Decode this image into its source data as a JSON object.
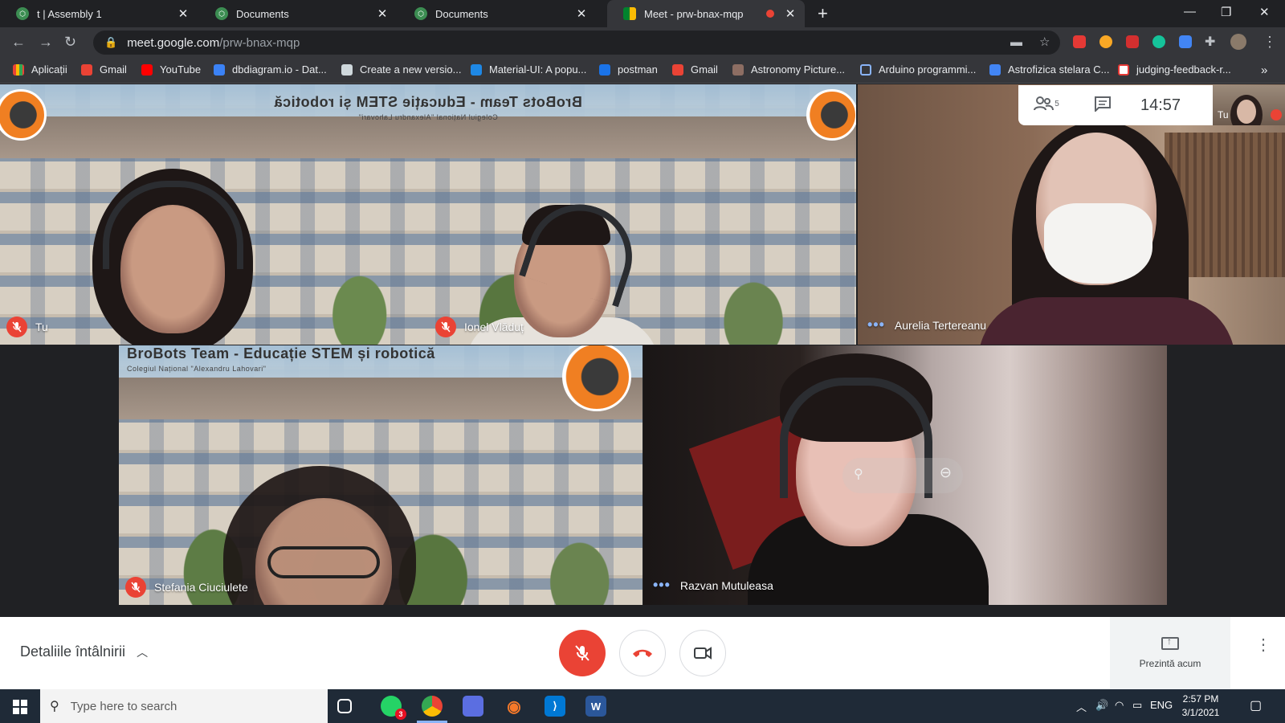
{
  "browser": {
    "tabs": [
      {
        "title": "t | Assembly 1",
        "active": false
      },
      {
        "title": "Documents",
        "active": false
      },
      {
        "title": "Documents",
        "active": false
      },
      {
        "title": "Meet - prw-bnax-mqp",
        "active": true
      }
    ],
    "url_host": "meet.google.com",
    "url_path": "/prw-bnax-mqp",
    "bookmarks": [
      "Aplicații",
      "Gmail",
      "YouTube",
      "dbdiagram.io - Dat...",
      "Create a new versio...",
      "Material-UI: A popu...",
      "postman",
      "Gmail",
      "Astronomy Picture...",
      "Arduino programmi...",
      "Astrofizica stelara C...",
      "judging-feedback-r..."
    ]
  },
  "meet": {
    "people_count": "5",
    "time": "14:57",
    "self_mini_label": "Tu",
    "banner_title": "BroBots Team - Educație STEM și robotică",
    "banner_subtitle": "Colegiul Național \"Alexandru Lahovari\"",
    "participants": [
      {
        "name": "Tu",
        "muted": true
      },
      {
        "name": "Ionel Vlăduț",
        "muted": true
      },
      {
        "name": "Aurelia Tertereanu",
        "muted": false
      },
      {
        "name": "Stefania Ciuciulete",
        "muted": true
      },
      {
        "name": "Razvan Mutuleasa",
        "muted": false
      }
    ],
    "details_label": "Detaliile întâlnirii",
    "present_label": "Prezintă acum",
    "colors": {
      "danger": "#ea4335",
      "accent": "#8ab4f8"
    }
  },
  "taskbar": {
    "search_placeholder": "Type here to search",
    "whatsapp_badge": "3",
    "lang": "ENG",
    "time": "2:57 PM",
    "date": "3/1/2021"
  }
}
